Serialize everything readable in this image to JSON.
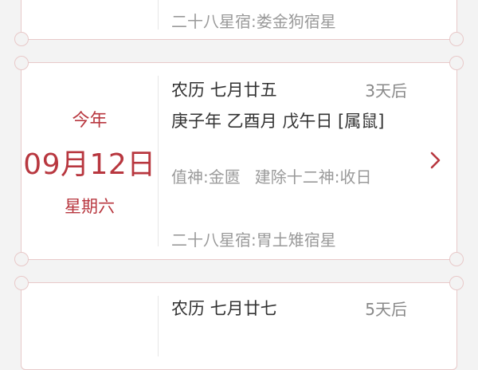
{
  "cards": [
    {
      "mansion": "二十八星宿:娄金狗宿星"
    },
    {
      "year_label": "今年",
      "date": "09月12日",
      "weekday": "星期六",
      "lunar": "农历 七月廿五",
      "days_after": "3天后",
      "ganzhi": "庚子年 乙酉月 戊午日 [属鼠]",
      "duty_god": "值神:金匮",
      "twelve_gods": "建除十二神:收日",
      "mansion": "二十八星宿:胃土雉宿星"
    },
    {
      "lunar": "农历 七月廿七",
      "days_after": "5天后"
    }
  ],
  "colors": {
    "accent": "#b8373f",
    "card_border": "#e8c9c9",
    "muted": "#9a9a9a",
    "background": "#f3f3f3"
  },
  "icons": {
    "chevron": "chevron-right-icon"
  }
}
